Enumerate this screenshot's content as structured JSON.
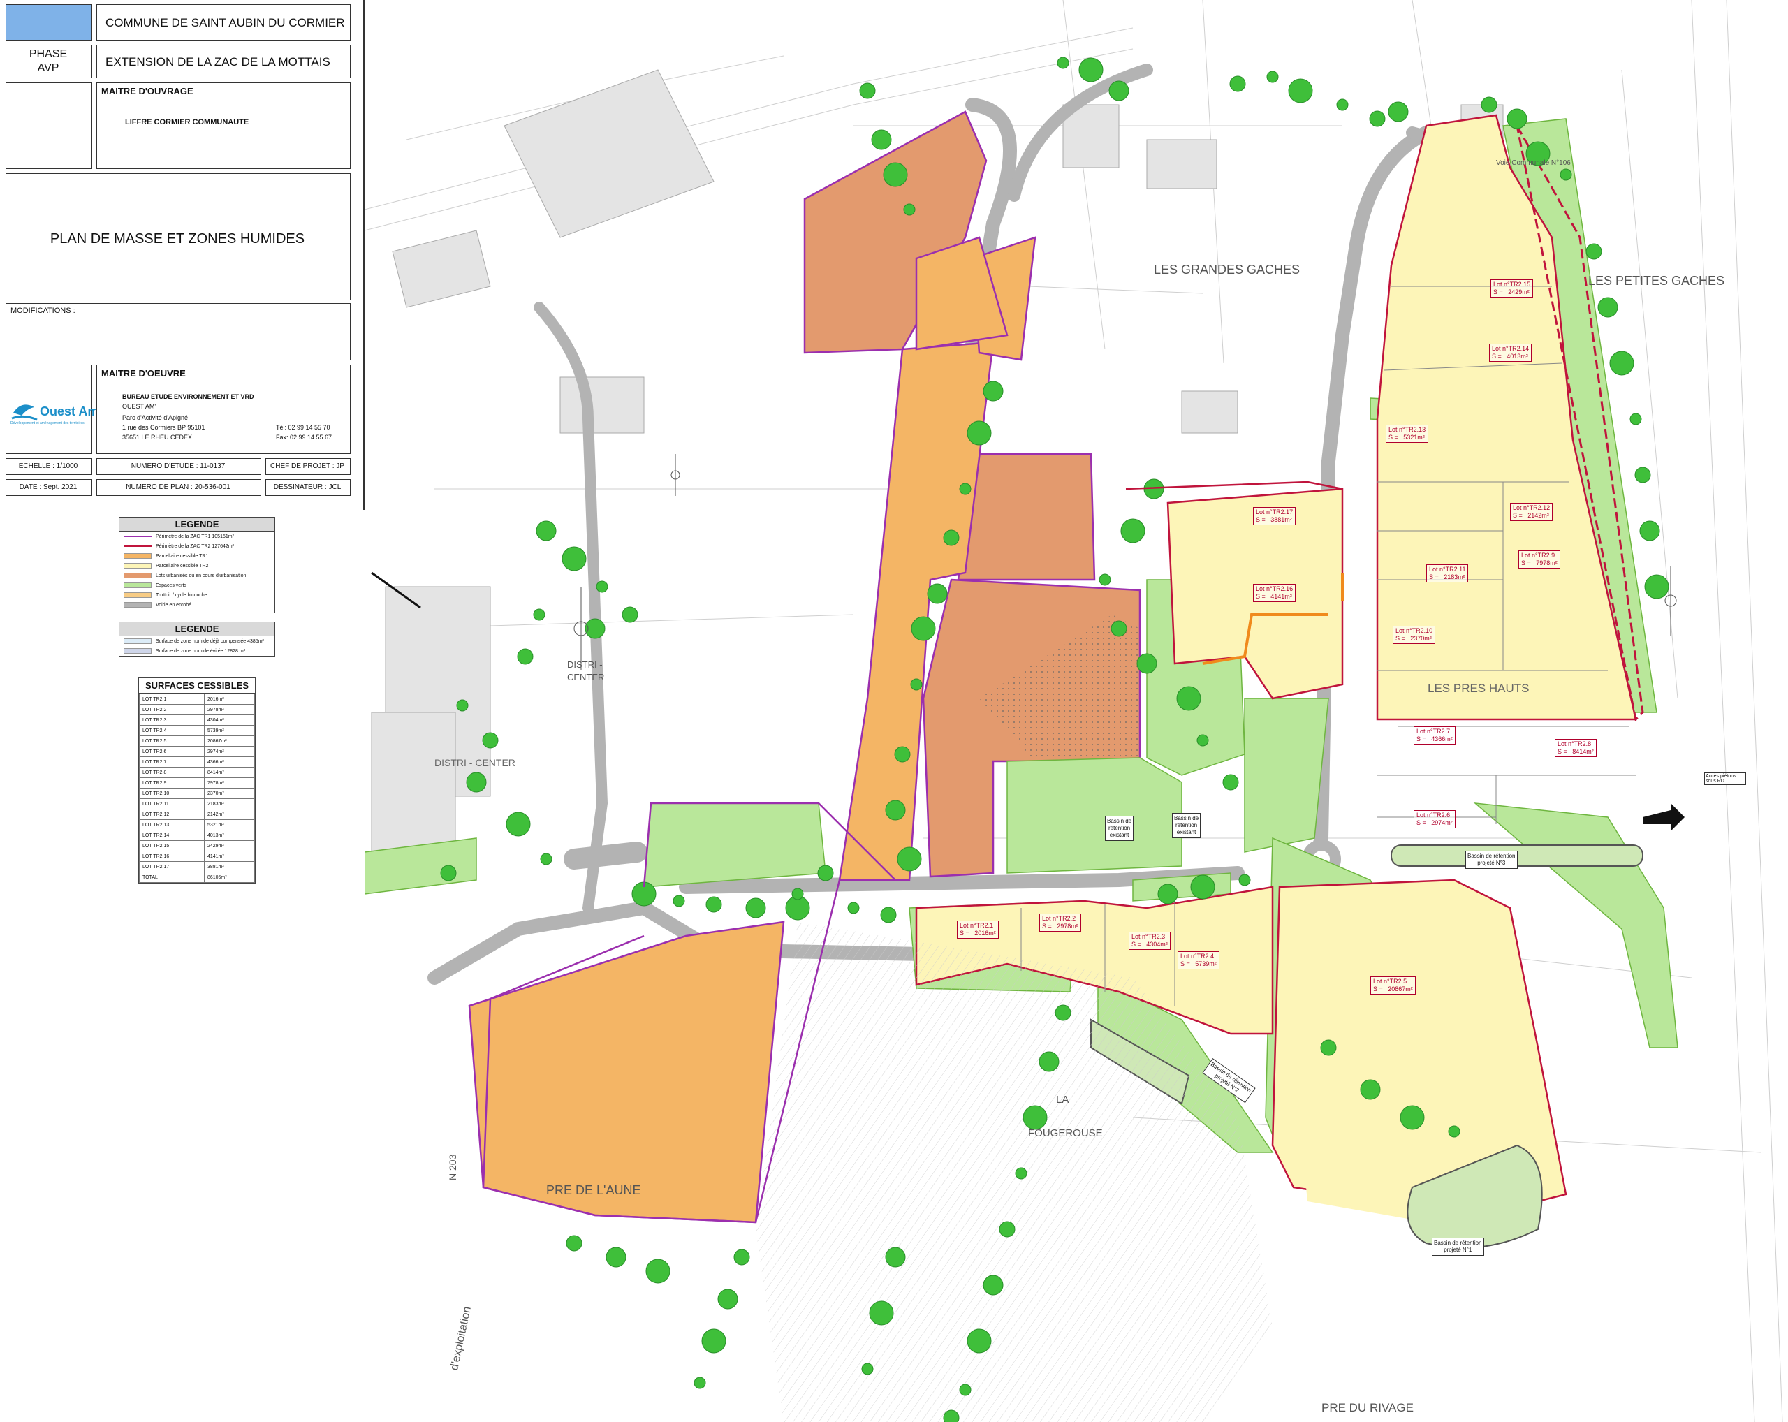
{
  "cartouche": {
    "commune": "COMMUNE DE SAINT AUBIN DU CORMIER",
    "phase_label": "PHASE",
    "phase_value": "AVP",
    "project": "EXTENSION DE LA ZAC DE LA MOTTAIS",
    "maitre_ouvrage_label": "MAITRE D'OUVRAGE",
    "maitre_ouvrage": "LIFFRE CORMIER COMMUNAUTE",
    "plan_title": "PLAN DE MASSE ET ZONES HUMIDES",
    "modifications_label": "MODIFICATIONS :",
    "maitre_oeuvre_label": "MAITRE D'OEUVRE",
    "bureau": "BUREAU ETUDE ENVIRONNEMENT ET VRD",
    "company": "OUEST AM'",
    "address1": "Parc d'Activité d'Apigné",
    "address2": "1 rue des Cormiers  BP 95101",
    "address3": "35651 LE RHEU CEDEX",
    "tel": "Tél: 02 99 14 55 70",
    "fax": "Fax: 02 99 14 55 67",
    "logo_text": "Ouest Am'",
    "logo_tagline": "Développement et aménagement des territoires",
    "echelle": "ECHELLE : 1/1000",
    "numero_etude": "NUMERO D'ETUDE : 11-0137",
    "chef_projet": "CHEF DE PROJET : JP",
    "date": "DATE : Sept. 2021",
    "numero_plan": "NUMERO DE PLAN : 20-536-001",
    "dessinateur": "DESSINATEUR : JCL"
  },
  "legend1": {
    "title": "LEGENDE",
    "items": [
      {
        "label": "Périmètre de la ZAC TR1 105151m²",
        "color": "#9b2fae",
        "kind": "line"
      },
      {
        "label": "Périmètre de la ZAC TR2 127642m²",
        "color": "#c0143c",
        "kind": "line"
      },
      {
        "label": "Parcellaire cessible TR1",
        "color": "#f4b565",
        "kind": "fill"
      },
      {
        "label": "Parcellaire cessible TR2",
        "color": "#fdf5b8",
        "kind": "fill"
      },
      {
        "label": "Lots urbanisés ou en cours d'urbanisation",
        "color": "#e39a6e",
        "kind": "fill"
      },
      {
        "label": "Espaces verts",
        "color": "#b9e79a",
        "kind": "fill"
      },
      {
        "label": "Trottoir / cycle bicouche",
        "color": "#f7cc85",
        "kind": "fill"
      },
      {
        "label": "Voirie en enrobé",
        "color": "#b3b3b3",
        "kind": "fill"
      }
    ]
  },
  "legend2": {
    "title": "LEGENDE",
    "items": [
      {
        "label": "Surface de zone humide déjà compensée 4385m²",
        "color": "#dcecf8"
      },
      {
        "label": "Surface de zone humide évitée 12828 m²",
        "color": "#cfd6ea"
      }
    ]
  },
  "surfaces": {
    "title": "SURFACES CESSIBLES",
    "rows": [
      [
        "LOT TR2.1",
        "2016m²"
      ],
      [
        "LOT TR2.2",
        "2978m²"
      ],
      [
        "LOT TR2.3",
        "4304m²"
      ],
      [
        "LOT TR2.4",
        "5739m²"
      ],
      [
        "LOT TR2.5",
        "20867m²"
      ],
      [
        "LOT TR2.6",
        "2974m²"
      ],
      [
        "LOT TR2.7",
        "4366m²"
      ],
      [
        "LOT TR2.8",
        "8414m²"
      ],
      [
        "LOT TR2.9",
        "7978m²"
      ],
      [
        "LOT TR2.10",
        "2370m²"
      ],
      [
        "LOT TR2.11",
        "2183m²"
      ],
      [
        "LOT TR2.12",
        "2142m²"
      ],
      [
        "LOT TR2.13",
        "5321m²"
      ],
      [
        "LOT TR2.14",
        "4013m²"
      ],
      [
        "LOT TR2.15",
        "2429m²"
      ],
      [
        "LOT TR2.16",
        "4141m²"
      ],
      [
        "LOT TR2.17",
        "3881m²"
      ],
      [
        "TOTAL",
        "86105m²"
      ]
    ]
  },
  "map": {
    "places": {
      "grandes_gaches": "LES   GRANDES   GACHES",
      "petites_gaches": "LES  PETITES  GACHES",
      "pres_hauts": "LES PRES HAUTS",
      "pre_aune": "PRE DE L'AUNE",
      "pre_rivage": "PRE DU RIVAGE",
      "fougerouse_a": "LA",
      "fougerouse_b": "FOUGEROUSE",
      "distri1": "DISTRI -",
      "distri2": "CENTER",
      "distri_center": "DISTRI - CENTER",
      "exploitation": "d'exploitation",
      "voie": "Voie  Communale  N°106",
      "rn": "N 203",
      "acces": "Accès piétons sous RD"
    },
    "lots": [
      {
        "label": "Lot n°TR2.15\nS =   2429m²"
      },
      {
        "label": "Lot n°TR2.14\nS =   4013m²"
      },
      {
        "label": "Lot n°TR2.13\nS =   5321m²"
      },
      {
        "label": "Lot n°TR2.12\nS =   2142m²"
      },
      {
        "label": "Lot n°TR2.11\nS =   2183m²"
      },
      {
        "label": "Lot n°TR2.9\nS =   7978m²"
      },
      {
        "label": "Lot n°TR2.10\nS =   2370m²"
      },
      {
        "label": "Lot n°TR2.7\nS =   4366m²"
      },
      {
        "label": "Lot n°TR2.8\nS =   8414m²"
      },
      {
        "label": "Lot n°TR2.6\nS =   2974m²"
      },
      {
        "label": "Lot n°TR2.17\nS =   3881m²"
      },
      {
        "label": "Lot n°TR2.16\nS =   4141m²"
      },
      {
        "label": "Lot n°TR2.1\nS =   2016m²"
      },
      {
        "label": "Lot n°TR2.2\nS =   2978m²"
      },
      {
        "label": "Lot n°TR2.3\nS =   4304m²"
      },
      {
        "label": "Lot n°TR2.4\nS =   5739m²"
      },
      {
        "label": "Lot n°TR2.5\nS =   20867m²"
      }
    ],
    "basins": {
      "b1": "Bassin de\nrétention\nexistant",
      "b2": "Bassin de\nrétention\nexistant",
      "b3": "Bassin de rétention\nprojeté N°3",
      "b4": "Bassin de rétention\nprojeté N°1",
      "b5": "Bassin de rétention\nprojeté N°2"
    },
    "colors": {
      "tr1": "#f4b565",
      "tr2": "#fdf5b8",
      "urban": "#e39a6e",
      "green": "#b9e79a",
      "road": "#b3b3b3",
      "trees": "#3fbf3a",
      "perim1": "#9b2fae",
      "perim2": "#c0143c"
    }
  }
}
